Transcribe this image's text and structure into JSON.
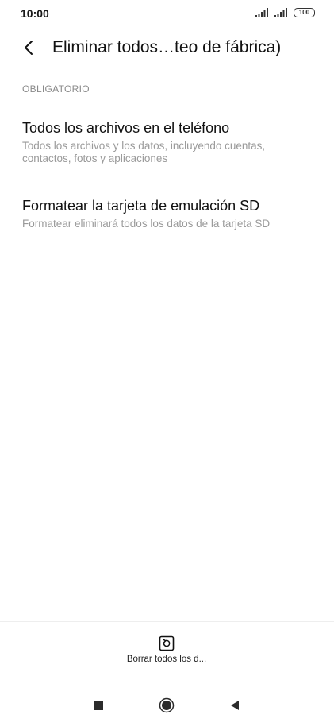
{
  "status_bar": {
    "time": "10:00",
    "battery": "100"
  },
  "header": {
    "title": "Eliminar todos…teo de fábrica)"
  },
  "section": {
    "label": "OBLIGATORIO"
  },
  "items": [
    {
      "title": "Todos los archivos en el teléfono",
      "subtitle": "Todos los archivos y los datos, incluyendo cuentas, contactos, fotos y aplicaciones"
    },
    {
      "title": "Formatear la tarjeta de emulación SD",
      "subtitle": "Formatear eliminará todos los datos de la tarjeta SD"
    }
  ],
  "bottom_action": {
    "label": "Borrar todos los d..."
  },
  "icons": {
    "back": "chevron-left-icon",
    "reset": "reset-icon",
    "nav_recents": "square-icon",
    "nav_home": "circle-icon",
    "nav_back": "triangle-back-icon"
  }
}
